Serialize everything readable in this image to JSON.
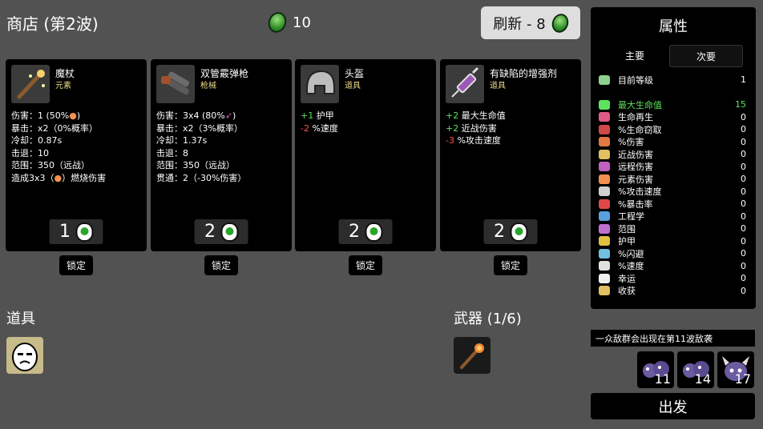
{
  "header": {
    "title": "商店 (第2波)",
    "currency": "10",
    "refresh_label": "刷新 - 8"
  },
  "cards": [
    {
      "name": "魔杖",
      "type": "元素",
      "lines": [
        "伤害：1 (50%",
        "暴击：x2（0%概率）",
        "冷却：0.87s",
        "击退：10",
        "范围：350（远战）",
        "造成3x3（",
        "）燃烧伤害"
      ],
      "price": "1",
      "lock": "锁定"
    },
    {
      "name": "双管霰弹枪",
      "type": "枪械",
      "lines": [
        "伤害：3x4 (80%",
        "暴击：x2（3%概率）",
        "冷却：1.37s",
        "击退：8",
        "范围：350（远战）",
        "贯通：2（-30%伤害）"
      ],
      "price": "2",
      "lock": "锁定"
    },
    {
      "name": "头盔",
      "type": "道具",
      "lines": [
        "+1",
        "护甲",
        "-2",
        "%速度"
      ],
      "price": "2",
      "lock": "锁定"
    },
    {
      "name": "有缺陷的增强剂",
      "type": "道具",
      "lines": [
        "+2",
        "最大生命值",
        "+2",
        "近战伤害",
        "-3",
        "%攻击速度"
      ],
      "price": "2",
      "lock": "锁定"
    }
  ],
  "items_section": {
    "label": "道具"
  },
  "weapons_section": {
    "label": "武器 (1/6)"
  },
  "stats_panel": {
    "title": "属性",
    "tab_primary": "主要",
    "tab_secondary": "次要",
    "level_label": "目前等级",
    "level_value": "1",
    "rows": [
      {
        "label": "最大生命值",
        "value": "15",
        "color": "#5ee35e",
        "icon": "heart-icon",
        "icolor": "#5ee35e"
      },
      {
        "label": "生命再生",
        "value": "0",
        "color": "#ffffff",
        "icon": "regen-icon",
        "icolor": "#e05a8a"
      },
      {
        "label": "%生命窃取",
        "value": "0",
        "color": "#ffffff",
        "icon": "lifesteal-icon",
        "icolor": "#d04848"
      },
      {
        "label": "%伤害",
        "value": "0",
        "color": "#ffffff",
        "icon": "damage-icon",
        "icolor": "#e07a40"
      },
      {
        "label": "近战伤害",
        "value": "0",
        "color": "#ffffff",
        "icon": "melee-icon",
        "icolor": "#e0c060"
      },
      {
        "label": "远程伤害",
        "value": "0",
        "color": "#ffffff",
        "icon": "ranged-icon",
        "icolor": "#c060c0"
      },
      {
        "label": "元素伤害",
        "value": "0",
        "color": "#ffffff",
        "icon": "elemental-icon",
        "icolor": "#f09050"
      },
      {
        "label": "%攻击速度",
        "value": "0",
        "color": "#ffffff",
        "icon": "attack-speed-icon",
        "icolor": "#cfcfcf"
      },
      {
        "label": "%暴击率",
        "value": "0",
        "color": "#ffffff",
        "icon": "crit-icon",
        "icolor": "#e04848"
      },
      {
        "label": "工程学",
        "value": "0",
        "color": "#ffffff",
        "icon": "engineering-icon",
        "icolor": "#5aa0e0"
      },
      {
        "label": "范围",
        "value": "0",
        "color": "#ffffff",
        "icon": "range-icon",
        "icolor": "#c070d0"
      },
      {
        "label": "护甲",
        "value": "0",
        "color": "#ffffff",
        "icon": "armor-icon",
        "icolor": "#e0c040"
      },
      {
        "label": "%闪避",
        "value": "0",
        "color": "#ffffff",
        "icon": "dodge-icon",
        "icolor": "#70c0e0"
      },
      {
        "label": "%速度",
        "value": "0",
        "color": "#ffffff",
        "icon": "speed-icon",
        "icolor": "#e0e0e0"
      },
      {
        "label": "幸运",
        "value": "0",
        "color": "#ffffff",
        "icon": "luck-icon",
        "icolor": "#f0f0f0"
      },
      {
        "label": "收获",
        "value": "0",
        "color": "#ffffff",
        "icon": "harvest-icon",
        "icolor": "#e0c060"
      }
    ]
  },
  "wave_notice": "一众敌群会出现在第11波敌袭",
  "enemies": [
    {
      "count": "11",
      "icon": "enemy-bug-icon"
    },
    {
      "count": "14",
      "icon": "enemy-bug-icon"
    },
    {
      "count": "17",
      "icon": "enemy-horned-icon"
    }
  ],
  "go_label": "出发"
}
